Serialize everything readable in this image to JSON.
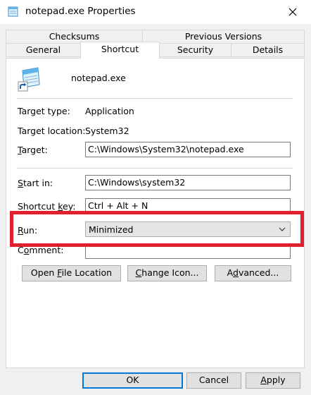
{
  "window": {
    "title": "notepad.exe Properties",
    "icon": "notepad-icon",
    "close_icon": "close-icon"
  },
  "tabs": {
    "row1": [
      {
        "label": "Checksums"
      },
      {
        "label": "Previous Versions"
      }
    ],
    "row2": [
      {
        "label": "General"
      },
      {
        "label": "Shortcut",
        "active": true
      },
      {
        "label": "Security"
      },
      {
        "label": "Details"
      }
    ]
  },
  "shortcut": {
    "file_name": "notepad.exe",
    "target_type_label": "Target type:",
    "target_type_value": "Application",
    "target_location_label": "Target location:",
    "target_location_value": "System32",
    "target_label_key": "T",
    "target_label_rest": "arget:",
    "target_value": "C:\\Windows\\System32\\notepad.exe",
    "start_in_label_key": "S",
    "start_in_label_rest": "tart in:",
    "start_in_value": "C:\\Windows\\system32",
    "shortcut_key_label_pre": "Shortcut ",
    "shortcut_key_label_key": "k",
    "shortcut_key_label_rest": "ey:",
    "shortcut_key_value": "Ctrl + Alt + N",
    "run_label_key": "R",
    "run_label_rest": "un:",
    "run_value": "Minimized",
    "comment_label_pre": "C",
    "comment_label_key": "o",
    "comment_label_rest": "mment:",
    "comment_value": ""
  },
  "actions": {
    "open_file_location_pre": "Open ",
    "open_file_location_key": "F",
    "open_file_location_rest": "ile Location",
    "change_icon_pre": "",
    "change_icon_key": "C",
    "change_icon_rest": "hange Icon...",
    "advanced_pre": "A",
    "advanced_key": "d",
    "advanced_rest": "vanced..."
  },
  "footer": {
    "ok_label": "OK",
    "cancel_label": "Cancel",
    "apply_key": "A",
    "apply_rest": "pply"
  },
  "colors": {
    "highlight": "#e0202e",
    "focus_border": "#0078d7"
  }
}
